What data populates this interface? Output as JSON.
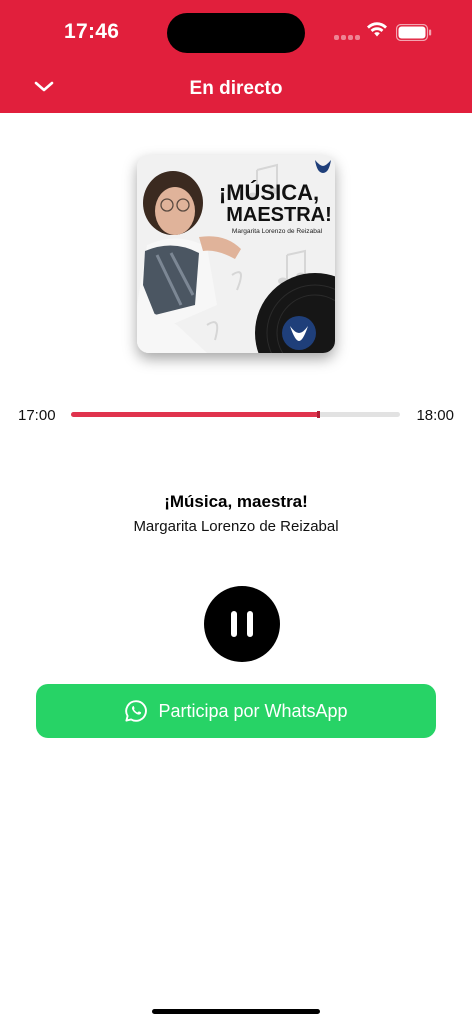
{
  "status_bar": {
    "time": "17:46"
  },
  "header": {
    "title": "En directo",
    "collapse_icon": "chevron-down-icon",
    "background_color": "#e11f3c"
  },
  "artwork": {
    "title_line1": "¡MÚSICA,",
    "title_line2": "MAESTRA!",
    "subtitle": "Margarita Lorenzo de Reizabal"
  },
  "progress": {
    "start_time": "17:00",
    "end_time": "18:00",
    "fraction": 0.757,
    "fill_color": "#e0334d"
  },
  "program": {
    "title": "¡Música, maestra!",
    "host": "Margarita Lorenzo de Reizabal"
  },
  "player": {
    "state_icon": "pause-icon"
  },
  "whatsapp": {
    "label": "Participa por WhatsApp",
    "icon": "whatsapp-icon",
    "color": "#27d366"
  }
}
